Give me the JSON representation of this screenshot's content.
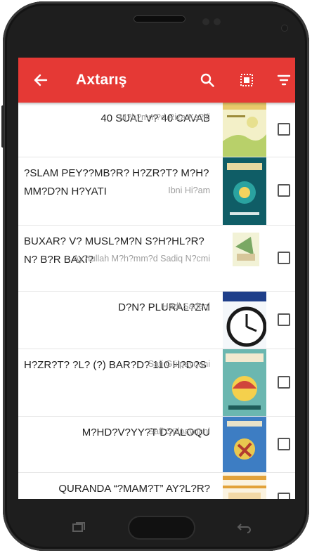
{
  "appbar": {
    "title": "Axtarış",
    "color": "#e53935",
    "icons": [
      "back-arrow-icon",
      "search-icon",
      "select-all-icon",
      "filter-icon"
    ]
  },
  "books": [
    {
      "title": "40 SUAL V? 40 CAVAB",
      "author": "M?h?mm?d Riza Ka?ifi",
      "align": "right",
      "checked": false
    },
    {
      "title": "?SLAM PEY??MB?R? H?ZR?T? M?H?MM?D?N H?YATI",
      "author": "Ibni Hi?am",
      "align": "left",
      "checked": false
    },
    {
      "title": "BUXAR? V? MUSL?M?N S?H?HL?R?N? B?R BAXI?",
      "author": "Ay?tullah M?h?mm?d Sadiq N?cmi",
      "align": "left",
      "checked": false
    },
    {
      "title": "D?N? PLURAL?ZM",
      "author": "Hadi Sadeqi",
      "align": "right",
      "checked": false
    },
    {
      "title": "H?ZR?T? ?L? (?) BAR?D? 110 H?D?S",
      "author": "Safi Gülpayqani",
      "align": "left",
      "checked": false
    },
    {
      "title": "M?HD?V?YY?T D?ALOQU",
      "author": "Safi Gülpayqani",
      "align": "right",
      "checked": false
    },
    {
      "title": "QURANDA “?MAM?T” AY?L?R?",
      "author": "",
      "align": "right",
      "checked": false
    }
  ]
}
